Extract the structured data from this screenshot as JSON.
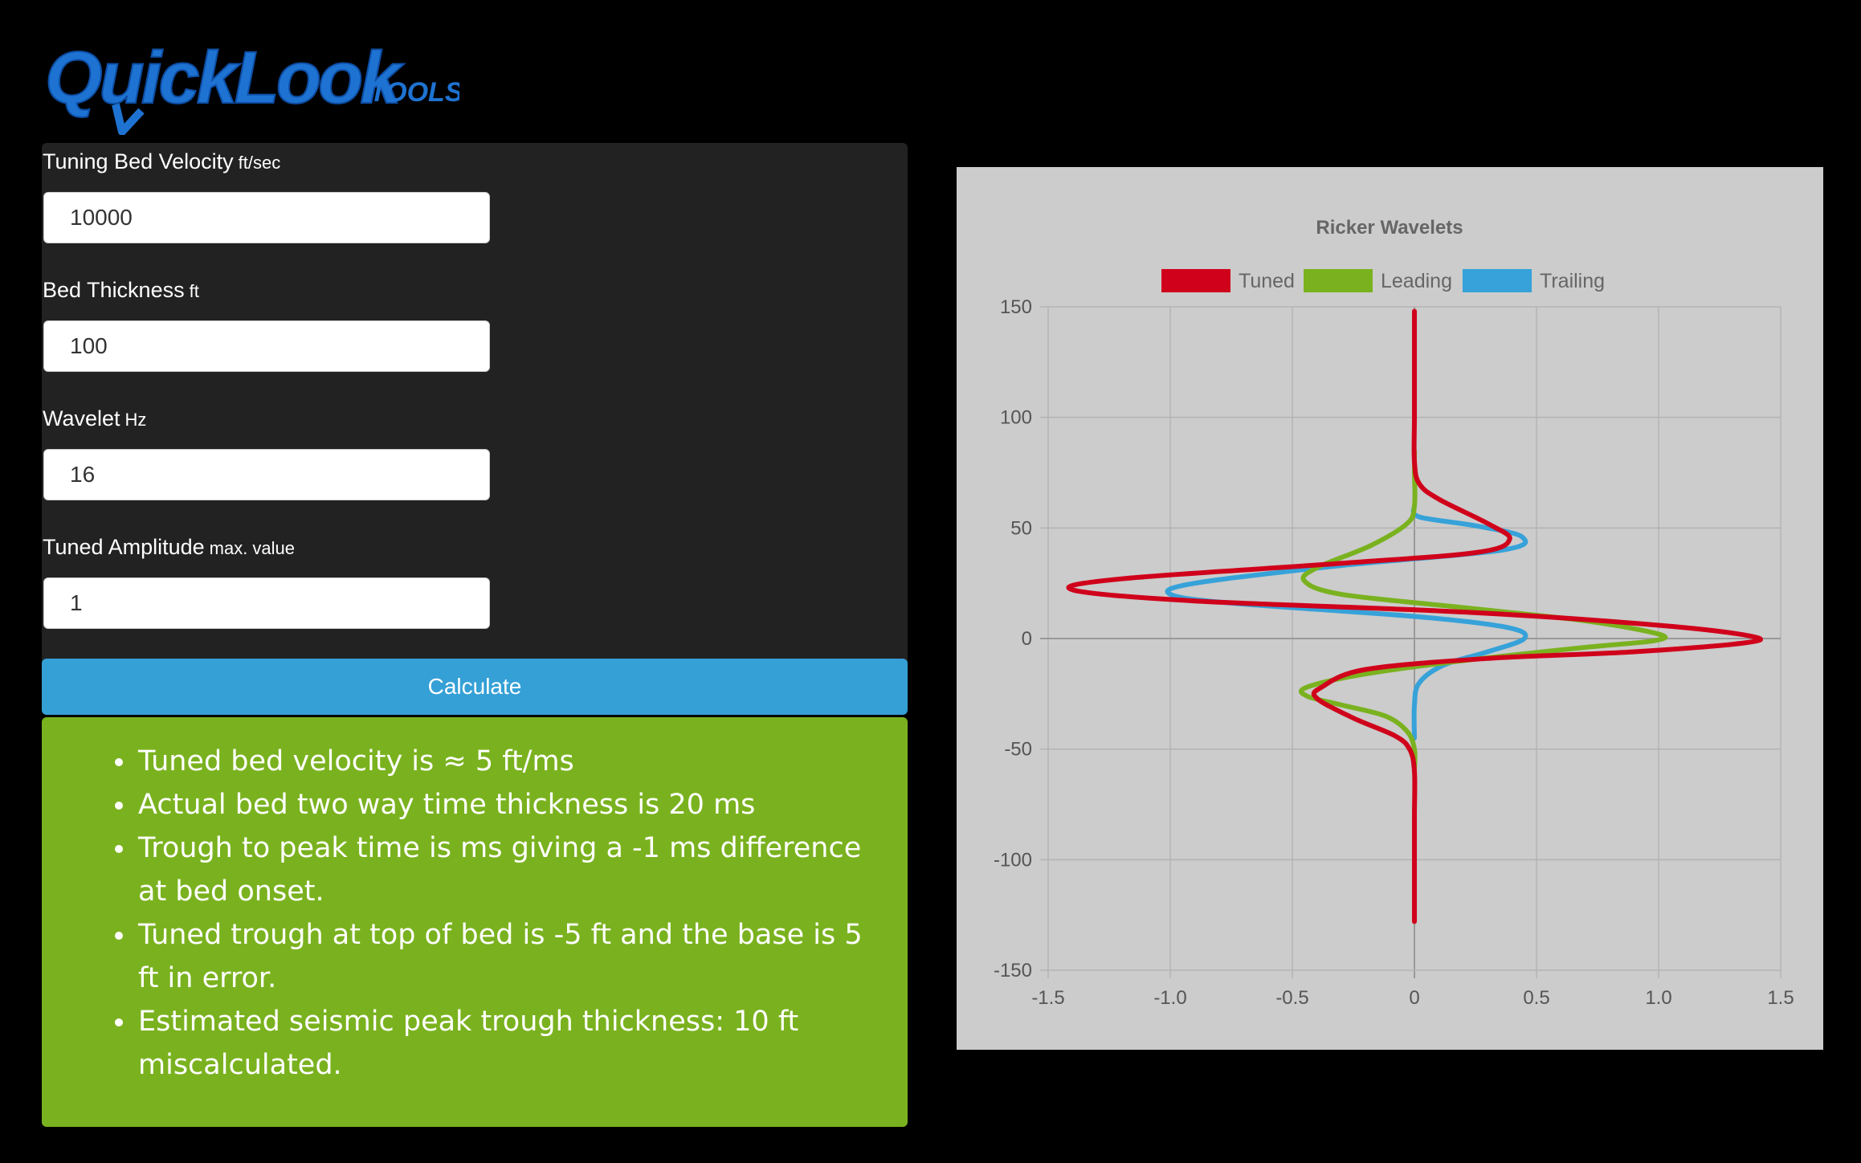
{
  "app": {
    "logo_text": "QuickLook",
    "logo_sub": "TOOLS"
  },
  "form": {
    "fields": [
      {
        "label": "Tuning Bed Velocity",
        "unit": "ft/sec",
        "value": "10000"
      },
      {
        "label": "Bed Thickness",
        "unit": "ft",
        "value": "100"
      },
      {
        "label": "Wavelet",
        "unit": "Hz",
        "value": "16"
      },
      {
        "label": "Tuned Amplitude",
        "unit": "max. value",
        "value": "1"
      }
    ],
    "calculate_label": "Calculate"
  },
  "results": {
    "items": [
      "Tuned bed velocity is ≈ 5 ft/ms",
      "Actual bed two way time thickness is 20 ms",
      "Trough to peak time is ms giving a -1 ms difference at bed onset.",
      "Tuned trough at top of bed is -5 ft and the base is 5 ft in error.",
      "Estimated seismic peak trough thickness: 10 ft miscalculated."
    ]
  },
  "colors": {
    "tuned": "#d0021b",
    "leading": "#7ab21f",
    "trailing": "#36a2d9",
    "results_bg": "#7ab21f",
    "button_bg": "#35a0d6"
  },
  "chart_data": {
    "type": "line",
    "title": "Ricker Wavelets",
    "legend_position": "top",
    "xlim": [
      -1.5,
      1.5
    ],
    "ylim": [
      -150,
      150
    ],
    "x_ticks": [
      "-1.5",
      "-1.0",
      "-0.5",
      "0",
      "0.5",
      "1.0",
      "1.5"
    ],
    "y_ticks": [
      "150",
      "100",
      "50",
      "0",
      "-50",
      "-100",
      "-150"
    ],
    "grid": true,
    "series": [
      {
        "name": "Tuned",
        "color": "#d0021b",
        "points": [
          [
            0,
            148
          ],
          [
            0,
            120
          ],
          [
            0,
            100
          ],
          [
            0,
            80
          ],
          [
            0.02,
            70
          ],
          [
            0.1,
            63
          ],
          [
            0.3,
            52
          ],
          [
            0.39,
            45
          ],
          [
            0.26,
            39
          ],
          [
            -0.3,
            34
          ],
          [
            -1.2,
            27
          ],
          [
            -1.4,
            22
          ],
          [
            -0.9,
            17
          ],
          [
            0.2,
            12
          ],
          [
            1.0,
            6
          ],
          [
            1.38,
            1
          ],
          [
            1.35,
            -2
          ],
          [
            0.9,
            -6
          ],
          [
            0.3,
            -9
          ],
          [
            -0.2,
            -14
          ],
          [
            -0.38,
            -22
          ],
          [
            -0.4,
            -27
          ],
          [
            -0.25,
            -36
          ],
          [
            -0.08,
            -44
          ],
          [
            -0.02,
            -50
          ],
          [
            0,
            -60
          ],
          [
            0,
            -80
          ],
          [
            0,
            -100
          ],
          [
            0,
            -128
          ]
        ]
      },
      {
        "name": "Leading",
        "color": "#7ab21f",
        "points": [
          [
            0,
            85
          ],
          [
            0,
            75
          ],
          [
            0,
            60
          ],
          [
            -0.03,
            52
          ],
          [
            -0.18,
            42
          ],
          [
            -0.4,
            32
          ],
          [
            -0.45,
            26
          ],
          [
            -0.3,
            20
          ],
          [
            0.2,
            14
          ],
          [
            0.7,
            8
          ],
          [
            1.0,
            2
          ],
          [
            0.98,
            -1
          ],
          [
            0.7,
            -4
          ],
          [
            0.2,
            -10
          ],
          [
            -0.2,
            -16
          ],
          [
            -0.44,
            -22
          ],
          [
            -0.44,
            -26
          ],
          [
            -0.3,
            -30
          ],
          [
            -0.12,
            -35
          ],
          [
            -0.03,
            -42
          ],
          [
            0,
            -50
          ],
          [
            0,
            -60
          ]
        ]
      },
      {
        "name": "Trailing",
        "color": "#36a2d9",
        "points": [
          [
            0,
            60
          ],
          [
            0.02,
            55
          ],
          [
            0.25,
            51
          ],
          [
            0.44,
            46
          ],
          [
            0.36,
            40
          ],
          [
            -0.3,
            33
          ],
          [
            -0.9,
            25
          ],
          [
            -1.0,
            20
          ],
          [
            -0.75,
            16
          ],
          [
            0,
            10
          ],
          [
            0.38,
            5
          ],
          [
            0.45,
            0
          ],
          [
            0.3,
            -6
          ],
          [
            0.12,
            -12
          ],
          [
            0.02,
            -20
          ],
          [
            0,
            -30
          ],
          [
            0,
            -45
          ]
        ]
      }
    ]
  }
}
